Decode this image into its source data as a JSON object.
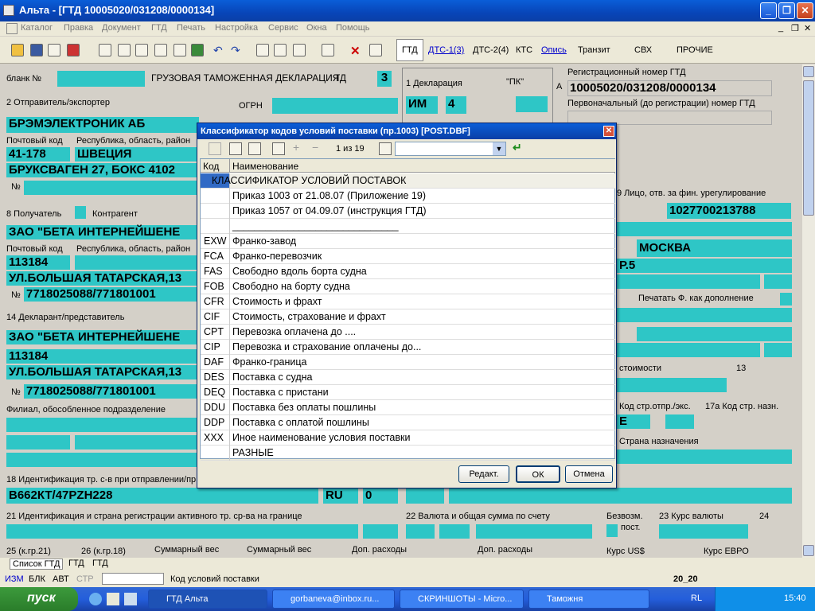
{
  "window": {
    "title": "Альта - [ГТД 10005020/031208/0000134]"
  },
  "menu": [
    "Каталог",
    "Правка",
    "Документ",
    "ГТД",
    "Печать",
    "Настройка",
    "Сервис",
    "Окна",
    "Помощь"
  ],
  "tabs": {
    "gtd": "ГТД",
    "dts1": "ДТС-1(3)",
    "dts2": "ДТС-2(4)",
    "kts": "КТС",
    "opis": "Опись",
    "tranzit": "Транзит",
    "svh": "СВХ",
    "prochie": "ПРОЧИЕ"
  },
  "form": {
    "blank": "бланк №",
    "header": "ГРУЗОВАЯ ТАМОЖЕННАЯ ДЕКЛАРАЦИЯ",
    "td": "ТД",
    "td_num": "3",
    "decl": "1 Декларация",
    "pk": "\"ПК\"",
    "im": "ИМ",
    "four": "4",
    "reg_lbl": "Регистрационный номер ГТД",
    "a": "А",
    "reg_num": "10005020/031208/0000134",
    "first_num_lbl": "Первоначальный (до регистрации) номер ГТД",
    "sender_lbl": "2 Отправитель/экспортер",
    "ogrn": "ОГРН",
    "sender": "БРЭМЭЛЕКТРОНИК АБ",
    "postcode_lbl": "Почтовый код",
    "region_lbl": "Республика, область, район",
    "s_post": "41-178",
    "s_country": "ШВЕЦИЯ",
    "s_addr": "БРУКСВАГЕН 27, БОКС 4102",
    "no": "№",
    "recv_lbl": "8 Получатель",
    "kontragent": "Контрагент",
    "recv": "ЗАО \"БЕТА  ИНТЕРНЕЙШЕНЕ",
    "r_post": "113184",
    "r_addr": "УЛ.БОЛЬШАЯ ТАТАРСКАЯ,13",
    "r_inn": "7718025088/771801001",
    "fin_lbl": "9 Лицо, отв. за фин. урегулирование",
    "fin_num": "1027700213788",
    "moskva": "МОСКВА",
    "r5": "Р.5",
    "print_dop": "Печатать Ф. как дополнение",
    "decl_lbl": "14 Декларант/представитель",
    "d_name": "ЗАО \"БЕТА  ИНТЕРНЕЙШЕНЕ",
    "d_post": "113184",
    "d_addr": "УЛ.БОЛЬШАЯ ТАТАРСКАЯ,13",
    "d_inn": "7718025088/771801001",
    "filial": "Филиал, обособленное подразделение",
    "stoim": "стоимости",
    "n13": "13",
    "kod_otpr": "Код стр.отпр./экс.",
    "kod_nazn": "17a Код стр. назн.",
    "e": "Е",
    "strana_nazn": "Страна назначения",
    "ident_lbl": "18 Идентификация тр. с-в при отправлении/пр",
    "ident": "В662КТ/47PZH228",
    "ru": "RU",
    "zero": "0",
    "act_lbl": "21 Идентификация и страна регистрации активного тр. ср-ва на границе",
    "val_lbl": "22 Валюта и общая сумма по счету",
    "bezv": "Безвозм.",
    "post": "пост.",
    "kurs_lbl": "23 Курс валюты",
    "n24": "24",
    "b25": "25 (к.гр.21)",
    "b26": "26 (к.гр.18)",
    "summ1": "Суммарный вес",
    "summ2": "Суммарный вес",
    "dop1": "Доп. расходы",
    "dop2": "Доп. расходы",
    "kursusd": "Курс US$",
    "kurseur": "Курс ЕВРО"
  },
  "dialog": {
    "title": "Классификатор кодов условий поставки (пр.1003)  [POST.DBF]",
    "page": "1 из 19",
    "col_code": "Код",
    "col_name": "Наименование",
    "rows": [
      {
        "c": "",
        "n": "КЛАССИФИКАТОР УСЛОВИЙ ПОСТАВОК"
      },
      {
        "c": "",
        "n": "Приказ 1003 от 21.08.07 (Приложение 19)"
      },
      {
        "c": "",
        "n": "Приказ 1057 от 04.09.07 (инструкция ГТД)"
      },
      {
        "c": "",
        "n": "______________________________"
      },
      {
        "c": "EXW",
        "n": "Франко-завод"
      },
      {
        "c": "FCA",
        "n": "Франко-перевозчик"
      },
      {
        "c": "FAS",
        "n": "Свободно вдоль борта судна"
      },
      {
        "c": "FOB",
        "n": "Свободно на борту судна"
      },
      {
        "c": "CFR",
        "n": "Стоимость и фрахт"
      },
      {
        "c": "CIF",
        "n": "Стоимость, страхование и фрахт"
      },
      {
        "c": "CPT",
        "n": "Перевозка оплачена до ...."
      },
      {
        "c": "CIP",
        "n": "Перевозка и страхование оплачены до..."
      },
      {
        "c": "DAF",
        "n": "Франко-граница"
      },
      {
        "c": "DES",
        "n": "Поставка с судна"
      },
      {
        "c": "DEQ",
        "n": "Поставка с пристани"
      },
      {
        "c": "DDU",
        "n": "Поставка без оплаты пошлины"
      },
      {
        "c": "DDP",
        "n": "Поставка с оплатой пошлины"
      },
      {
        "c": "XXX",
        "n": "Иное наименование условия поставки"
      },
      {
        "c": "",
        "n": "РАЗНЫЕ"
      }
    ],
    "btn_edit": "Редакт.",
    "btn_ok": "ОК",
    "btn_cancel": "Отмена"
  },
  "bottomtabs": [
    "Список ГТД",
    "ГТД",
    "ГТД"
  ],
  "status": {
    "izm": "ИЗМ",
    "blk": "БЛК",
    "avt": "АВТ",
    "str": "СТР",
    "hint": "Код условий поставки",
    "pos": "20_20"
  },
  "taskbar": {
    "start": "пуск",
    "items": [
      "ГТД Альта",
      "gorbaneva@inbox.ru...",
      "СКРИНШОТЫ - Micro...",
      "Таможня"
    ],
    "lang": "RL",
    "time": "15:40"
  }
}
